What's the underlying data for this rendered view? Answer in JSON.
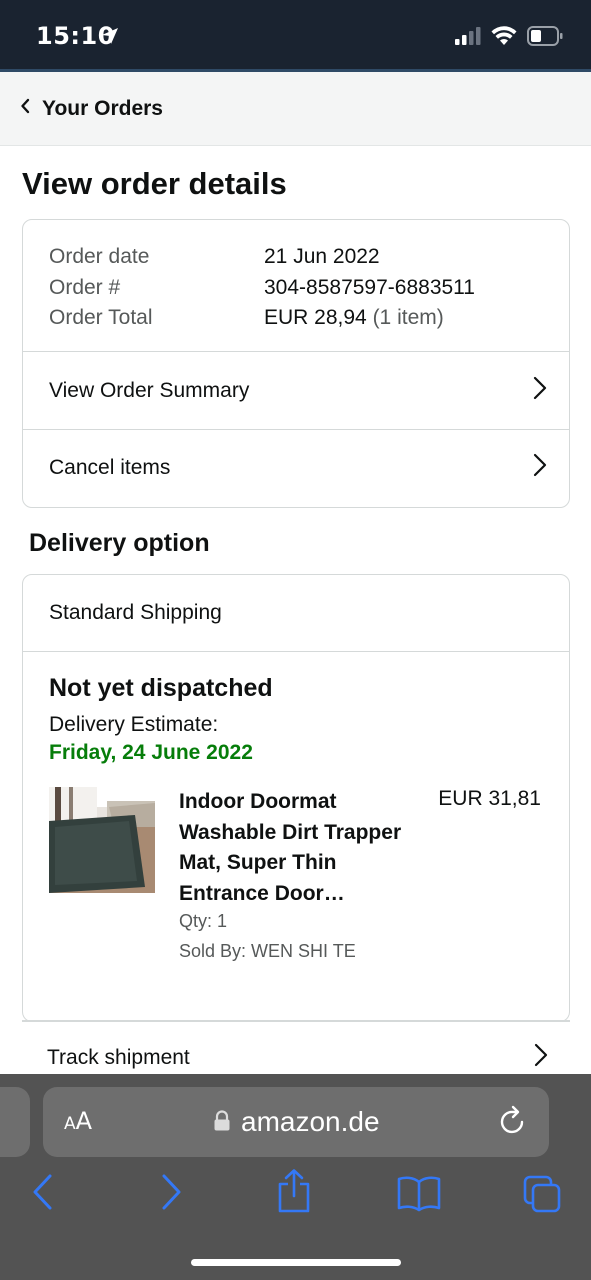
{
  "status_bar": {
    "time": "15:10"
  },
  "nav": {
    "back_label": "Your Orders"
  },
  "page": {
    "title": "View order details"
  },
  "order_info": {
    "rows": [
      {
        "label": "Order date",
        "value": "21 Jun 2022"
      },
      {
        "label": "Order #",
        "value": "304-8587597-6883511"
      },
      {
        "label": "Order Total",
        "value": "EUR 28,94",
        "sub": " (1 item)"
      }
    ]
  },
  "links": {
    "view_summary": "View Order Summary",
    "cancel_items": "Cancel items"
  },
  "delivery": {
    "section_title": "Delivery option",
    "shipping_method": "Standard Shipping",
    "status": "Not yet dispatched",
    "estimate_label": "Delivery Estimate:",
    "estimate_date": "Friday, 24 June 2022",
    "estimate_color": "#067d0a"
  },
  "item": {
    "name": "Indoor Doormat Washable Dirt Trapper Mat, Super Thin Entrance Door…",
    "price": "EUR 31,81",
    "qty": "Qty: 1",
    "seller": "Sold By: WEN SHI TE"
  },
  "track": {
    "label": "Track shipment"
  },
  "browser": {
    "aa_small": "A",
    "aa_big": "A",
    "url": "amazon.de",
    "accent": "#3478f6"
  }
}
